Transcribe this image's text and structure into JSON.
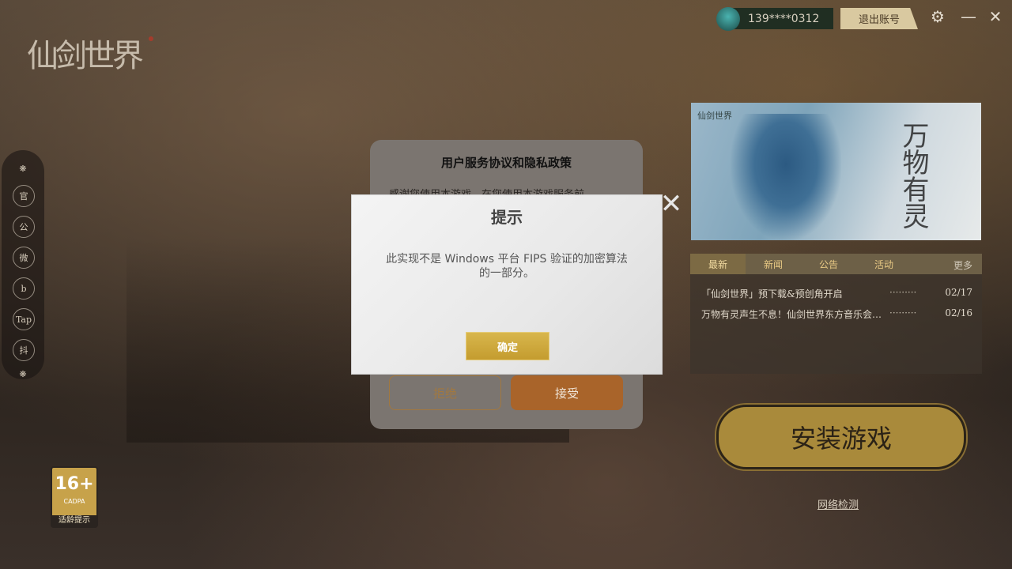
{
  "app": {
    "logo_text": "仙剑世界"
  },
  "topbar": {
    "phone": "139****0312",
    "logout_label": "退出账号",
    "settings_icon": "gear-icon",
    "minimize_icon": "minimize-icon",
    "close_icon": "close-icon"
  },
  "sidebar": {
    "items": [
      {
        "label": "官",
        "icon": "official-site-icon"
      },
      {
        "label": "公",
        "icon": "wechat-official-icon"
      },
      {
        "label": "微",
        "icon": "weibo-icon"
      },
      {
        "label": "b",
        "icon": "bilibili-icon"
      },
      {
        "label": "Tap",
        "icon": "taptap-icon"
      },
      {
        "label": "抖",
        "icon": "douyin-icon"
      }
    ]
  },
  "age_rating": {
    "number": "16+",
    "sub": "CADPA",
    "footer": "适龄提示"
  },
  "banner": {
    "mini_logo": "仙剑世界",
    "title": "万物有灵"
  },
  "news": {
    "tabs": [
      "最新",
      "新闻",
      "公告",
      "活动"
    ],
    "active_tab": "最新",
    "more_label": "更多",
    "items": [
      {
        "title": "「仙剑世界」预下载&预创角开启",
        "date": "02/17"
      },
      {
        "title": "万物有灵声生不息！仙剑世界东方音乐会即将开启",
        "date": "02/16"
      }
    ]
  },
  "install_label": "安装游戏",
  "network_check_label": "网络检测",
  "agreement_dialog": {
    "title": "用户服务协议和隐私政策",
    "body": "感谢您使用本游戏，在您使用本游戏服务前",
    "reject_label": "拒绝",
    "accept_label": "接受"
  },
  "alert": {
    "title": "提示",
    "message": "此实现不是 Windows 平台 FIPS 验证的加密算法的一部分。",
    "ok_label": "确定"
  },
  "colors": {
    "install_gold": "#a98a3b",
    "accept_brown": "#a9642a",
    "ok_gold": "#d2ad40"
  }
}
